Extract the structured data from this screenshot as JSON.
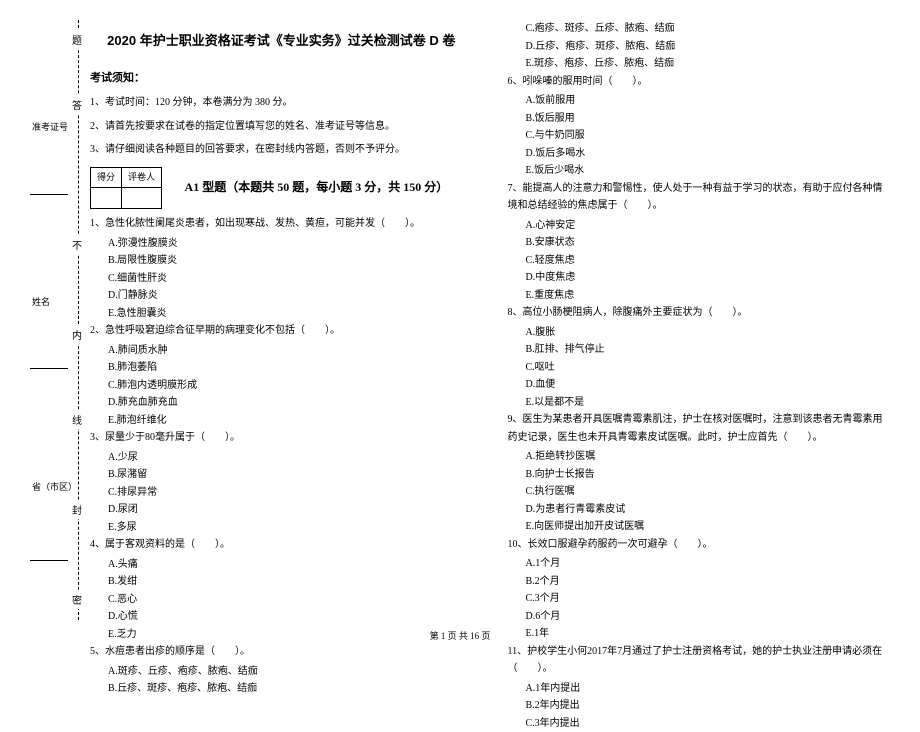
{
  "title": "2020 年护士职业资格证考试《专业实务》过关检测试卷 D 卷",
  "instructions_header": "考试须知：",
  "instructions": [
    "1、考试时间：120 分钟，本卷满分为 380 分。",
    "2、请首先按要求在试卷的指定位置填写您的姓名、准考证号等信息。",
    "3、请仔细阅读各种题目的回答要求，在密封线内答题，否则不予评分。"
  ],
  "score_table": {
    "col1": "得分",
    "col2": "评卷人"
  },
  "section_a1": "A1 型题（本题共 50 题，每小题 3 分，共 150 分）",
  "binding_chars": [
    "题",
    "答",
    "不",
    "内",
    "线",
    "封",
    "密"
  ],
  "binding_fields": {
    "id": "准考证号",
    "name": "姓名",
    "region": "省（市区）"
  },
  "questions_col1": [
    {
      "stem": "1、急性化脓性阑尾炎患者，如出现寒战、发热、黄疸，可能并发（　　）。",
      "opts": [
        "A.弥漫性腹膜炎",
        "B.局限性腹膜炎",
        "C.细菌性肝炎",
        "D.门静脉炎",
        "E.急性胆囊炎"
      ]
    },
    {
      "stem": "2、急性呼吸窘迫综合征早期的病理变化不包括（　　）。",
      "opts": [
        "A.肺间质水肿",
        "B.肺泡萎陷",
        "C.肺泡内透明膜形成",
        "D.肺充血肺充血",
        "E.肺泡纤维化"
      ]
    },
    {
      "stem": "3、尿量少于80毫升属于（　　）。",
      "opts": [
        "A.少尿",
        "B.尿潴留",
        "C.排尿异常",
        "D.尿闭",
        "E.多尿"
      ]
    },
    {
      "stem": "4、属于客观资料的是（　　）。",
      "opts": [
        "A.头痛",
        "B.发绀",
        "C.恶心",
        "D.心慌",
        "E.乏力"
      ]
    },
    {
      "stem": "5、水痘患者出疹的顺序是（　　）。",
      "opts": [
        "A.斑疹、丘疹、疱疹、脓疱、结痂",
        "B.丘疹、斑疹、疱疹、脓疱、结痂"
      ]
    }
  ],
  "questions_col2_top_opts": [
    "C.疱疹、斑疹、丘疹、脓疱、结痂",
    "D.丘疹、疱疹、斑疹、脓疱、结痂",
    "E.斑疹、疱疹、丘疹、脓疱、结痂"
  ],
  "questions_col2": [
    {
      "stem": "6、吲哚嗪的服用时间（　　）。",
      "opts": [
        "A.饭前服用",
        "B.饭后服用",
        "C.与牛奶同服",
        "D.饭后多喝水",
        "E.饭后少喝水"
      ]
    },
    {
      "stem": "7、能提高人的注意力和警惕性，使人处于一种有益于学习的状态，有助于应付各种情境和总结经验的焦虑属于（　　）。",
      "opts": [
        "A.心神安定",
        "B.安康状态",
        "C.轻度焦虑",
        "D.中度焦虑",
        "E.重度焦虑"
      ]
    },
    {
      "stem": "8、高位小肠梗阻病人，除腹痛外主要症状为（　　）。",
      "opts": [
        "A.腹胀",
        "B.肛排、排气停止",
        "C.呕吐",
        "D.血便",
        "E.以是都不是"
      ]
    },
    {
      "stem": "9、医生为某患者开具医嘱青霉素肌注，护士在核对医嘱时，注意到该患者无青霉素用药史记录，医生也未开具青霉素皮试医嘱。此时，护士应首先（　　）。",
      "opts": [
        "A.拒绝转抄医嘱",
        "B.向护士长报告",
        "C.执行医嘱",
        "D.为患者行青霉素皮试",
        "E.向医师提出加开皮试医嘱"
      ]
    },
    {
      "stem": "10、长效口服避孕药服药一次可避孕（　　）。",
      "opts": [
        "A.1个月",
        "B.2个月",
        "C.3个月",
        "D.6个月",
        "E.1年"
      ]
    },
    {
      "stem": "11、护校学生小何2017年7月通过了护士注册资格考试，她的护士执业注册申请必须在（　　）。",
      "opts": [
        "A.1年内提出",
        "B.2年内提出",
        "C.3年内提出"
      ]
    }
  ],
  "footer": "第 1 页 共 16 页"
}
